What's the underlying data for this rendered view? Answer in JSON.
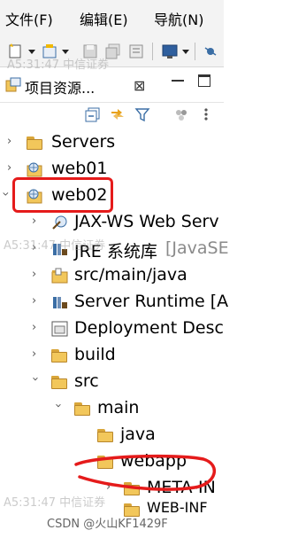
{
  "menu": [
    "文件(F)",
    "编辑(E)",
    "导航(N)"
  ],
  "panel": {
    "title": "项目资源...",
    "close": "⊠"
  },
  "tree": [
    {
      "label": "Servers",
      "icon": "folder-icon"
    },
    {
      "label": "web01",
      "icon": "project-icon"
    },
    {
      "label": "web02",
      "icon": "project-icon"
    },
    {
      "label": "JAX-WS Web Serv",
      "icon": "jaxws-icon"
    },
    {
      "label": "JRE 系统库",
      "suffix": "[JavaSE",
      "icon": "library-icon"
    },
    {
      "label": "src/main/java",
      "icon": "source-folder-icon"
    },
    {
      "label": "Server Runtime [A",
      "icon": "library-icon"
    },
    {
      "label": "Deployment Desc",
      "icon": "descriptor-icon"
    },
    {
      "label": "build",
      "icon": "folder-icon"
    },
    {
      "label": "src",
      "icon": "folder-icon"
    },
    {
      "label": "main",
      "icon": "folder-icon"
    },
    {
      "label": "java",
      "icon": "folder-icon"
    },
    {
      "label": "webapp",
      "icon": "folder-icon"
    },
    {
      "label": "META-IN",
      "icon": "folder-icon"
    },
    {
      "label": "WEB-INF",
      "icon": "folder-icon"
    }
  ],
  "watermark": {
    "stamp1": "A5:31:47  中信证券",
    "stamp2": "A5:31:47  中信证券",
    "stamp3": "A5:31:47  中信证券",
    "csdn": "CSDN @火山KF1429F"
  },
  "colors": {
    "highlight": "#e51b1b",
    "folder": "#f2c75b"
  }
}
